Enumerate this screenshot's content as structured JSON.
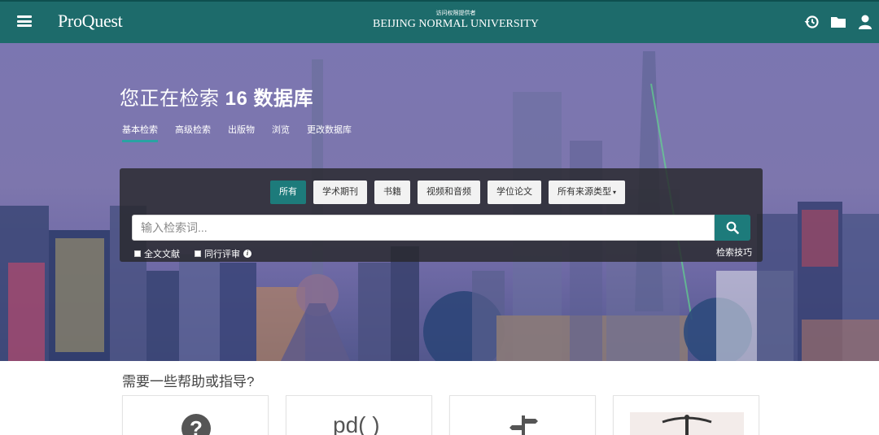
{
  "header": {
    "logo": "ProQuest",
    "institution_sub": "访问权限提供者",
    "institution_name": "BEIJING NORMAL UNIVERSITY",
    "icons": [
      "menu-icon",
      "history-icon",
      "folder-icon",
      "user-icon"
    ]
  },
  "hero": {
    "title_prefix": "您正在检索",
    "title_count": "16 数据库",
    "nav": [
      {
        "label": "基本检索",
        "active": true
      },
      {
        "label": "高级检索"
      },
      {
        "label": "出版物"
      },
      {
        "label": "浏览"
      },
      {
        "label": "更改数据库"
      }
    ]
  },
  "search": {
    "chips": [
      {
        "label": "所有",
        "active": true
      },
      {
        "label": "学术期刊"
      },
      {
        "label": "书籍"
      },
      {
        "label": "视频和音频"
      },
      {
        "label": "学位论文"
      },
      {
        "label": "所有来源类型",
        "caret": "▾"
      }
    ],
    "placeholder": "输入检索词...",
    "options": {
      "fulltext": "全文文献",
      "peer_reviewed": "同行评审"
    },
    "tips": "检索技巧"
  },
  "help": {
    "title": "需要一些帮助或指导?",
    "cards": [
      {
        "icon": "question-icon",
        "glyph": "?"
      },
      {
        "icon": "pdf-icon",
        "glyph": "pd( )"
      },
      {
        "icon": "signpost-icon"
      },
      {
        "icon": "law-scale-image"
      }
    ]
  },
  "colors": {
    "brand": "#1d6b6b",
    "accent": "#1d7b7b",
    "active_underline": "#29a3a3",
    "hero_sky": "#7b76b1"
  }
}
